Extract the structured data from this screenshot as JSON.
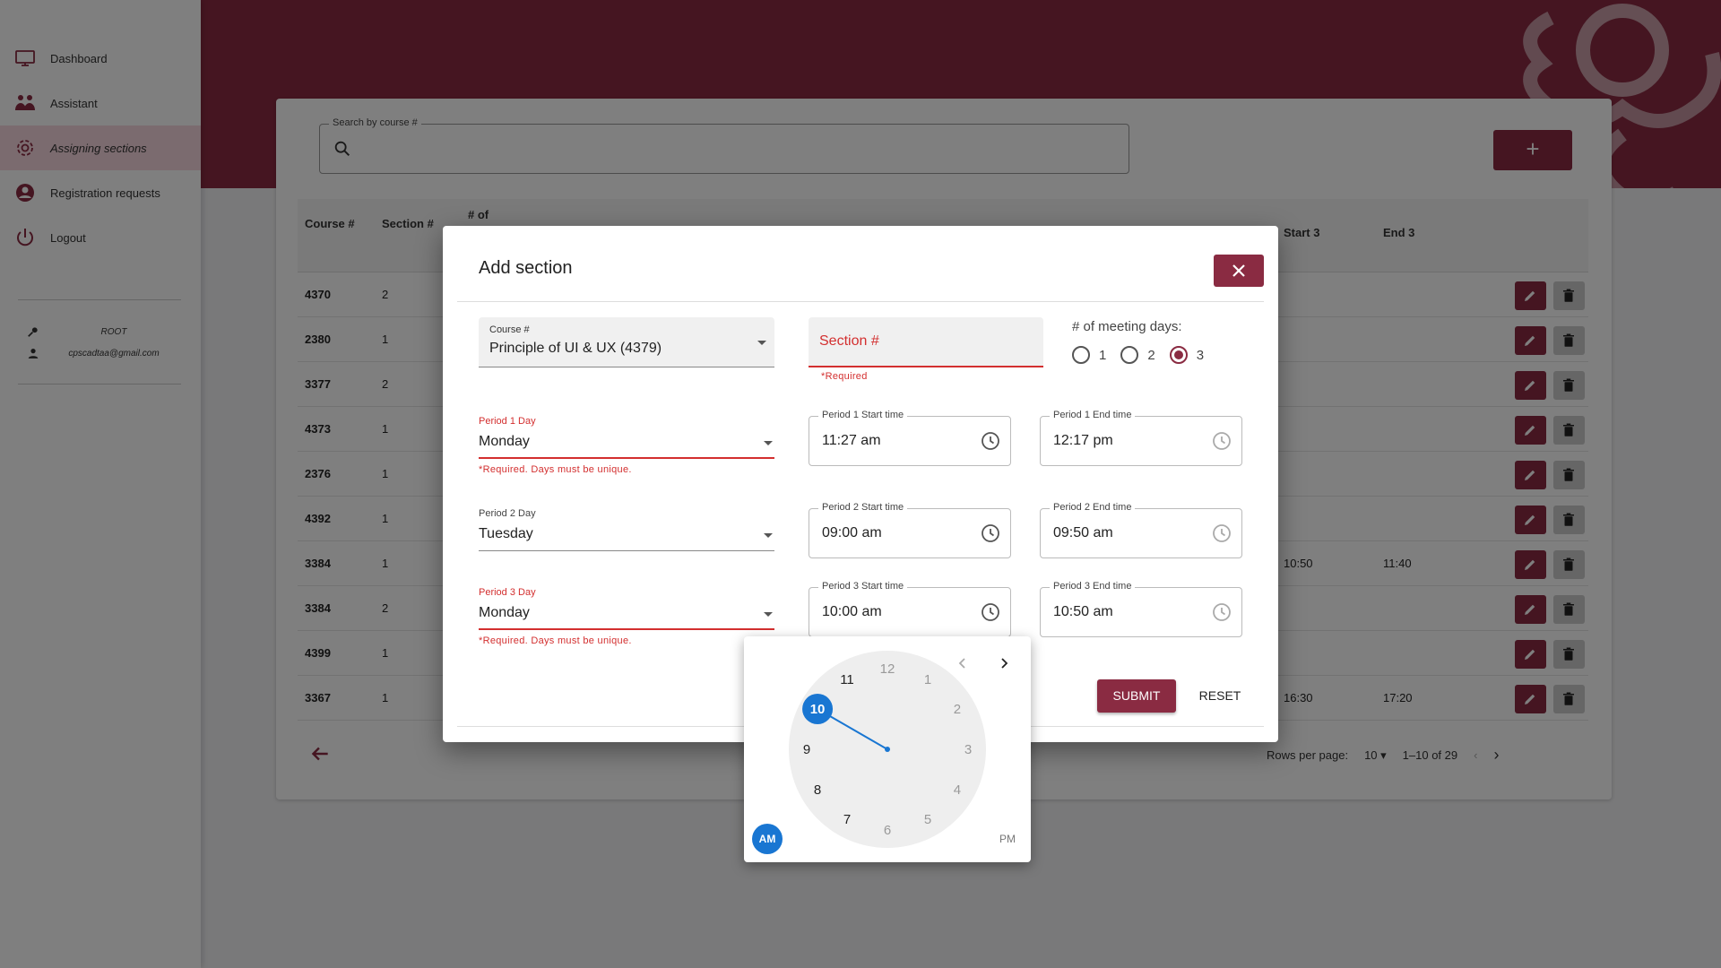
{
  "sidebar": {
    "items": [
      {
        "label": "Dashboard",
        "icon": "monitor-icon"
      },
      {
        "label": "Assistant",
        "icon": "people-icon"
      },
      {
        "label": "Assigning sections",
        "icon": "gear-icon"
      },
      {
        "label": "Registration requests",
        "icon": "account-circle-icon"
      },
      {
        "label": "Logout",
        "icon": "power-icon"
      }
    ],
    "user": {
      "role": "ROOT",
      "email": "cpscadtaa@gmail.com"
    }
  },
  "search": {
    "label": "Search by course #",
    "value": ""
  },
  "table": {
    "headers": {
      "course": "Course #",
      "section": "Section #",
      "meeting": "# of",
      "start3": "Start 3",
      "end3": "End 3"
    },
    "rows": [
      {
        "course": "4370",
        "section": "2",
        "start3": "",
        "end3": ""
      },
      {
        "course": "2380",
        "section": "1",
        "start3": "",
        "end3": ""
      },
      {
        "course": "3377",
        "section": "2",
        "start3": "",
        "end3": ""
      },
      {
        "course": "4373",
        "section": "1",
        "start3": "",
        "end3": ""
      },
      {
        "course": "2376",
        "section": "1",
        "start3": "",
        "end3": ""
      },
      {
        "course": "4392",
        "section": "1",
        "start3": "",
        "end3": ""
      },
      {
        "course": "3384",
        "section": "1",
        "start3": "10:50",
        "end3": "11:40"
      },
      {
        "course": "3384",
        "section": "2",
        "start3": "",
        "end3": ""
      },
      {
        "course": "4399",
        "section": "1",
        "start3": "",
        "end3": ""
      },
      {
        "course": "3367",
        "section": "1",
        "start3": "16:30",
        "end3": "17:20"
      }
    ]
  },
  "pagination": {
    "rows_label": "Rows per page:",
    "rows_value": "10",
    "range": "1–10 of 29"
  },
  "dialog": {
    "title": "Add section",
    "course": {
      "label": "Course #",
      "value": "Principle of UI & UX (4379)"
    },
    "section": {
      "placeholder": "Section #",
      "error": "*Required"
    },
    "meeting_days": {
      "label": "# of meeting days:",
      "options": [
        "1",
        "2",
        "3"
      ],
      "selected": "3"
    },
    "periods": [
      {
        "day_label": "Period 1 Day",
        "day": "Monday",
        "day_error": "*Required. Days must be unique.",
        "start_label": "Period 1 Start time",
        "start": "11:27 am",
        "end_label": "Period 1 End time",
        "end": "12:17 pm"
      },
      {
        "day_label": "Period 2 Day",
        "day": "Tuesday",
        "day_error": "",
        "start_label": "Period 2 Start time",
        "start": "09:00 am",
        "end_label": "Period 2 End time",
        "end": "09:50 am"
      },
      {
        "day_label": "Period 3 Day",
        "day": "Monday",
        "day_error": "*Required. Days must be unique.",
        "start_label": "Period 3 Start time",
        "start": "10:00 am",
        "end_label": "Period 3 End time",
        "end": "10:50 am"
      }
    ],
    "submit_label": "SUBMIT",
    "reset_label": "RESET"
  },
  "clock": {
    "numbers": [
      "12",
      "1",
      "2",
      "3",
      "4",
      "5",
      "6",
      "7",
      "8",
      "9",
      "10",
      "11"
    ],
    "selected_hour": "10",
    "am_label": "AM",
    "pm_label": "PM",
    "accent": "#1976d2"
  },
  "colors": {
    "brand": "#8a2b42",
    "error": "#d32f2f",
    "accent": "#1976d2"
  }
}
